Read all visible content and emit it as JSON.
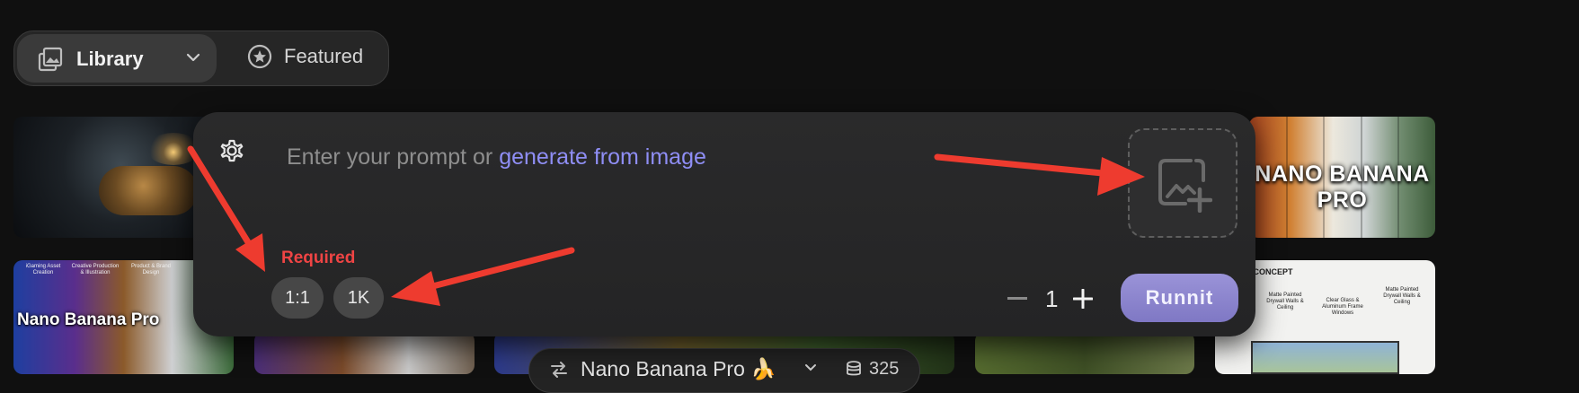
{
  "tabs": {
    "library_label": "Library",
    "library_icon": "image-gallery-icon",
    "featured_label": "Featured",
    "featured_icon": "star-circle-icon"
  },
  "gallery": {
    "nano_banana_pro_label": "NANO BANANA PRO",
    "nano_banana_pro_label_2": "Nano Banana Pro",
    "tile_captions": [
      "iGaming Asset Creation",
      "Creative Production & Illustration",
      "Product & Brand Design"
    ],
    "living_concept_title": "LIVING CONCEPT",
    "living_concept_notes": [
      "Matte Painted Drywall Walls & Ceiling",
      "Clear Glass & Aluminum Frame Windows",
      "Matte Painted Drywall Walls & Ceiling"
    ]
  },
  "prompt_card": {
    "settings_icon": "gear-icon",
    "placeholder_prefix": "Enter your prompt or ",
    "placeholder_link": "generate from image",
    "required_label": "Required",
    "aspect_ratio": "1:1",
    "resolution": "1K",
    "quantity": "1",
    "submit_label": "Runnit",
    "image_upload_icon": "add-image-icon"
  },
  "bottom_bar": {
    "model_name": "Nano Banana Pro 🍌",
    "credits": "325"
  },
  "colors": {
    "accent_link": "#8f8ef5",
    "submit_button": "#8a84cf",
    "required": "#ef4444",
    "annotation_arrow": "#ee3b2f"
  }
}
